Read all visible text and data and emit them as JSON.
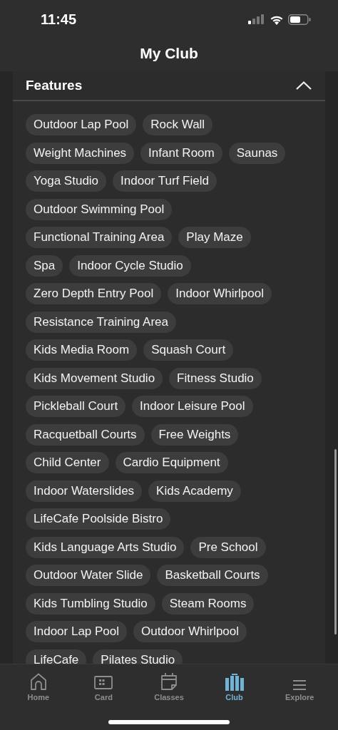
{
  "status_bar": {
    "time": "11:45"
  },
  "header": {
    "title": "My Club"
  },
  "features": {
    "title": "Features",
    "expanded": true,
    "rows": [
      [
        "Outdoor Lap Pool",
        "Rock Wall"
      ],
      [
        "Weight Machines",
        "Infant Room",
        "Saunas"
      ],
      [
        "Yoga Studio",
        "Indoor Turf Field"
      ],
      [
        "Outdoor Swimming Pool"
      ],
      [
        "Functional Training Area",
        "Play Maze"
      ],
      [
        "Spa",
        "Indoor Cycle Studio"
      ],
      [
        "Zero Depth Entry Pool",
        "Indoor Whirlpool"
      ],
      [
        "Resistance Training Area"
      ],
      [
        "Kids Media Room",
        "Squash Court"
      ],
      [
        "Kids Movement Studio",
        "Fitness Studio"
      ],
      [
        "Pickleball Court",
        "Indoor Leisure Pool"
      ],
      [
        "Racquetball Courts",
        "Free Weights"
      ],
      [
        "Child Center",
        "Cardio Equipment"
      ],
      [
        "Indoor Waterslides",
        "Kids Academy"
      ],
      [
        "LifeCafe Poolside Bistro"
      ],
      [
        "Kids Language Arts Studio",
        "Pre School"
      ],
      [
        "Outdoor Water Slide",
        "Basketball Courts"
      ],
      [
        "Kids Tumbling Studio",
        "Steam Rooms"
      ],
      [
        "Indoor Lap Pool",
        "Outdoor Whirlpool"
      ],
      [
        "LifeCafe",
        "Pilates Studio"
      ]
    ]
  },
  "tabs": [
    {
      "label": "Home",
      "kind": "home",
      "selected": false
    },
    {
      "label": "Card",
      "kind": "card",
      "selected": false
    },
    {
      "label": "Classes",
      "kind": "classes",
      "selected": false
    },
    {
      "label": "Club",
      "kind": "club",
      "selected": true
    },
    {
      "label": "Explore",
      "kind": "explore",
      "selected": false
    }
  ]
}
